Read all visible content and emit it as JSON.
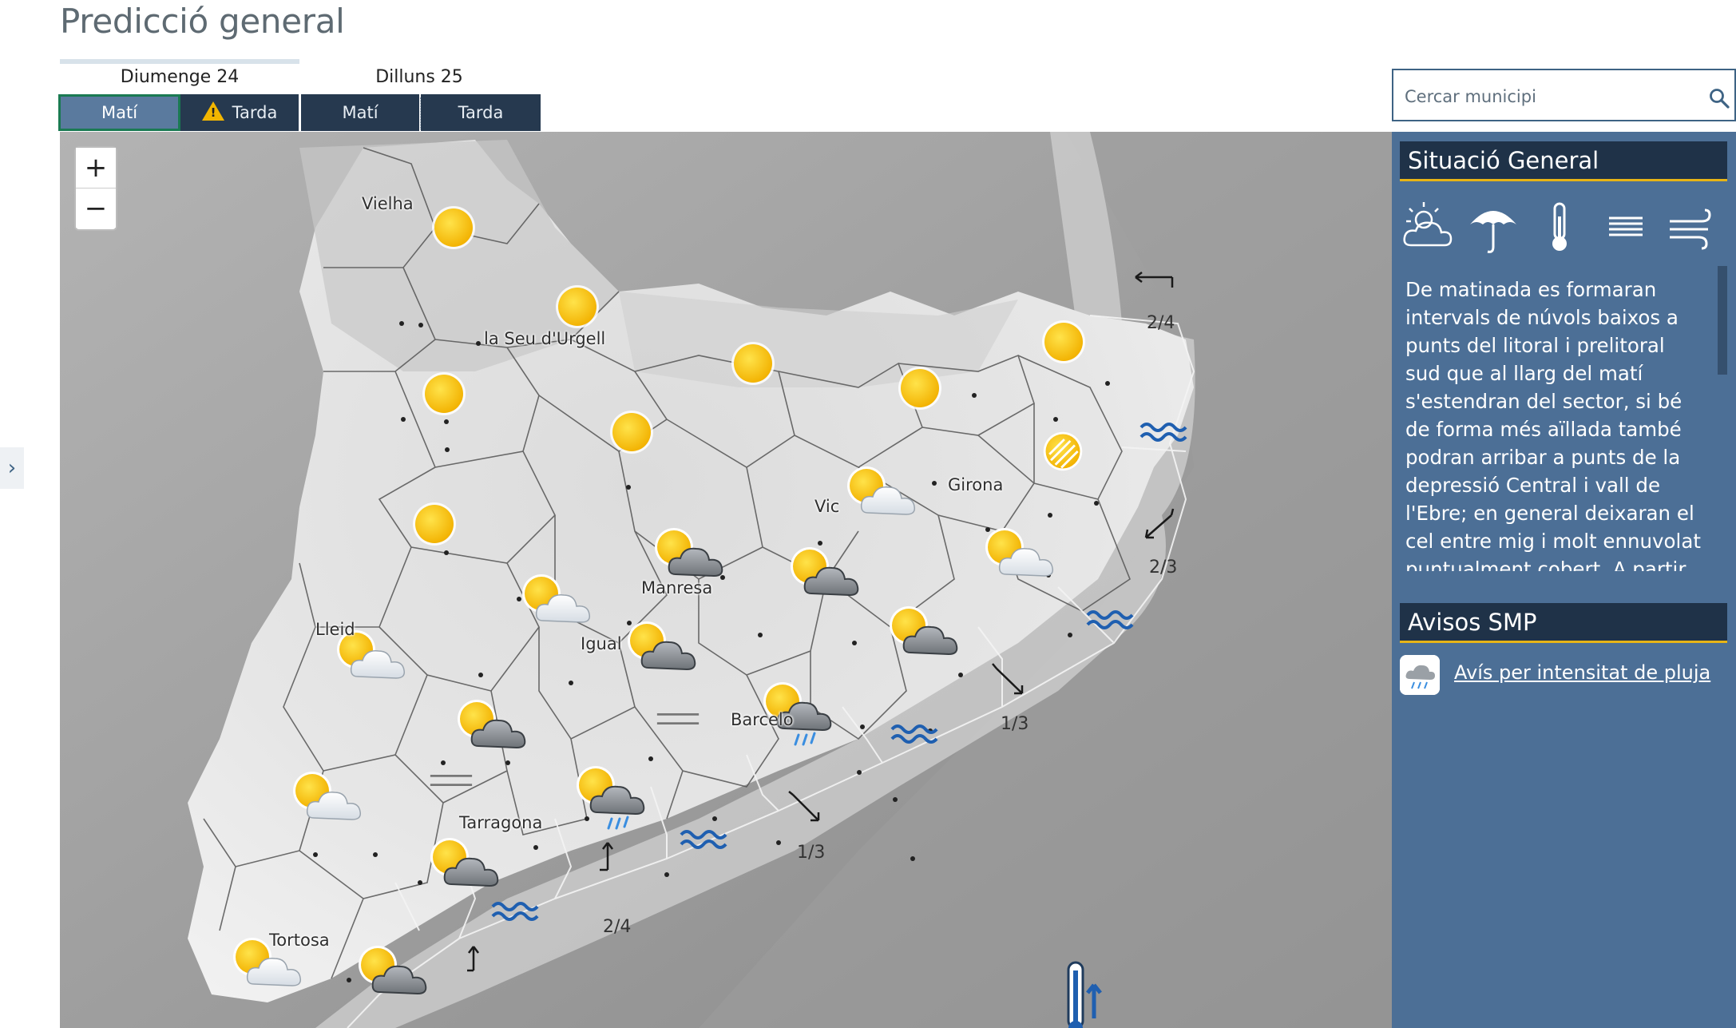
{
  "page": {
    "title": "Predicció general"
  },
  "days": [
    {
      "label": "Diumenge 24",
      "tabs": [
        {
          "label": "Matí",
          "active": true
        },
        {
          "label": "Tarda",
          "warning": true
        }
      ]
    },
    {
      "label": "Dilluns 25",
      "tabs": [
        {
          "label": "Matí"
        },
        {
          "label": "Tarda"
        }
      ]
    }
  ],
  "search": {
    "placeholder": "Cercar municipi"
  },
  "map": {
    "zoom_in": "+",
    "zoom_out": "−",
    "places": [
      "Vielha",
      "la Seu d'Urgell",
      "Vic",
      "Girona",
      "Manresa",
      "Igual",
      "Lleid",
      "Barcelo",
      "Tarragona",
      "Tortosa"
    ],
    "sea_states": [
      "2/4",
      "2/3",
      "1/3",
      "1/3",
      "2/4"
    ],
    "icons": [
      "sun",
      "partly-cloudy",
      "cloudy-sun",
      "rain",
      "fog",
      "haze",
      "waves",
      "wind-arrow",
      "thermometer-up"
    ]
  },
  "panel": {
    "general_title": "Situació General",
    "tools": [
      "cloud-sun-icon",
      "umbrella-icon",
      "thermometer-icon",
      "fog-icon",
      "wind-icon"
    ],
    "text": "De matinada es formaran intervals de núvols baixos a punts del litoral i prelitoral sud que al llarg del matí s'estendran del sector, si bé de forma més aïllada també podran arribar a punts de la depressió Central i vall de l'Ebre; en general deixaran el cel entre mig i molt ennuvolat puntualment cobert. A partir de migdia, creixeran",
    "warnings_title": "Avisos SMP",
    "warning_link": "Avís per intensitat de pluja"
  },
  "colors": {
    "nav": "#26394f",
    "active_tab": "#5a7a9e",
    "panel": "#4c6f96",
    "accent": "#e7b416",
    "sea_icon": "#1f5fb0"
  }
}
